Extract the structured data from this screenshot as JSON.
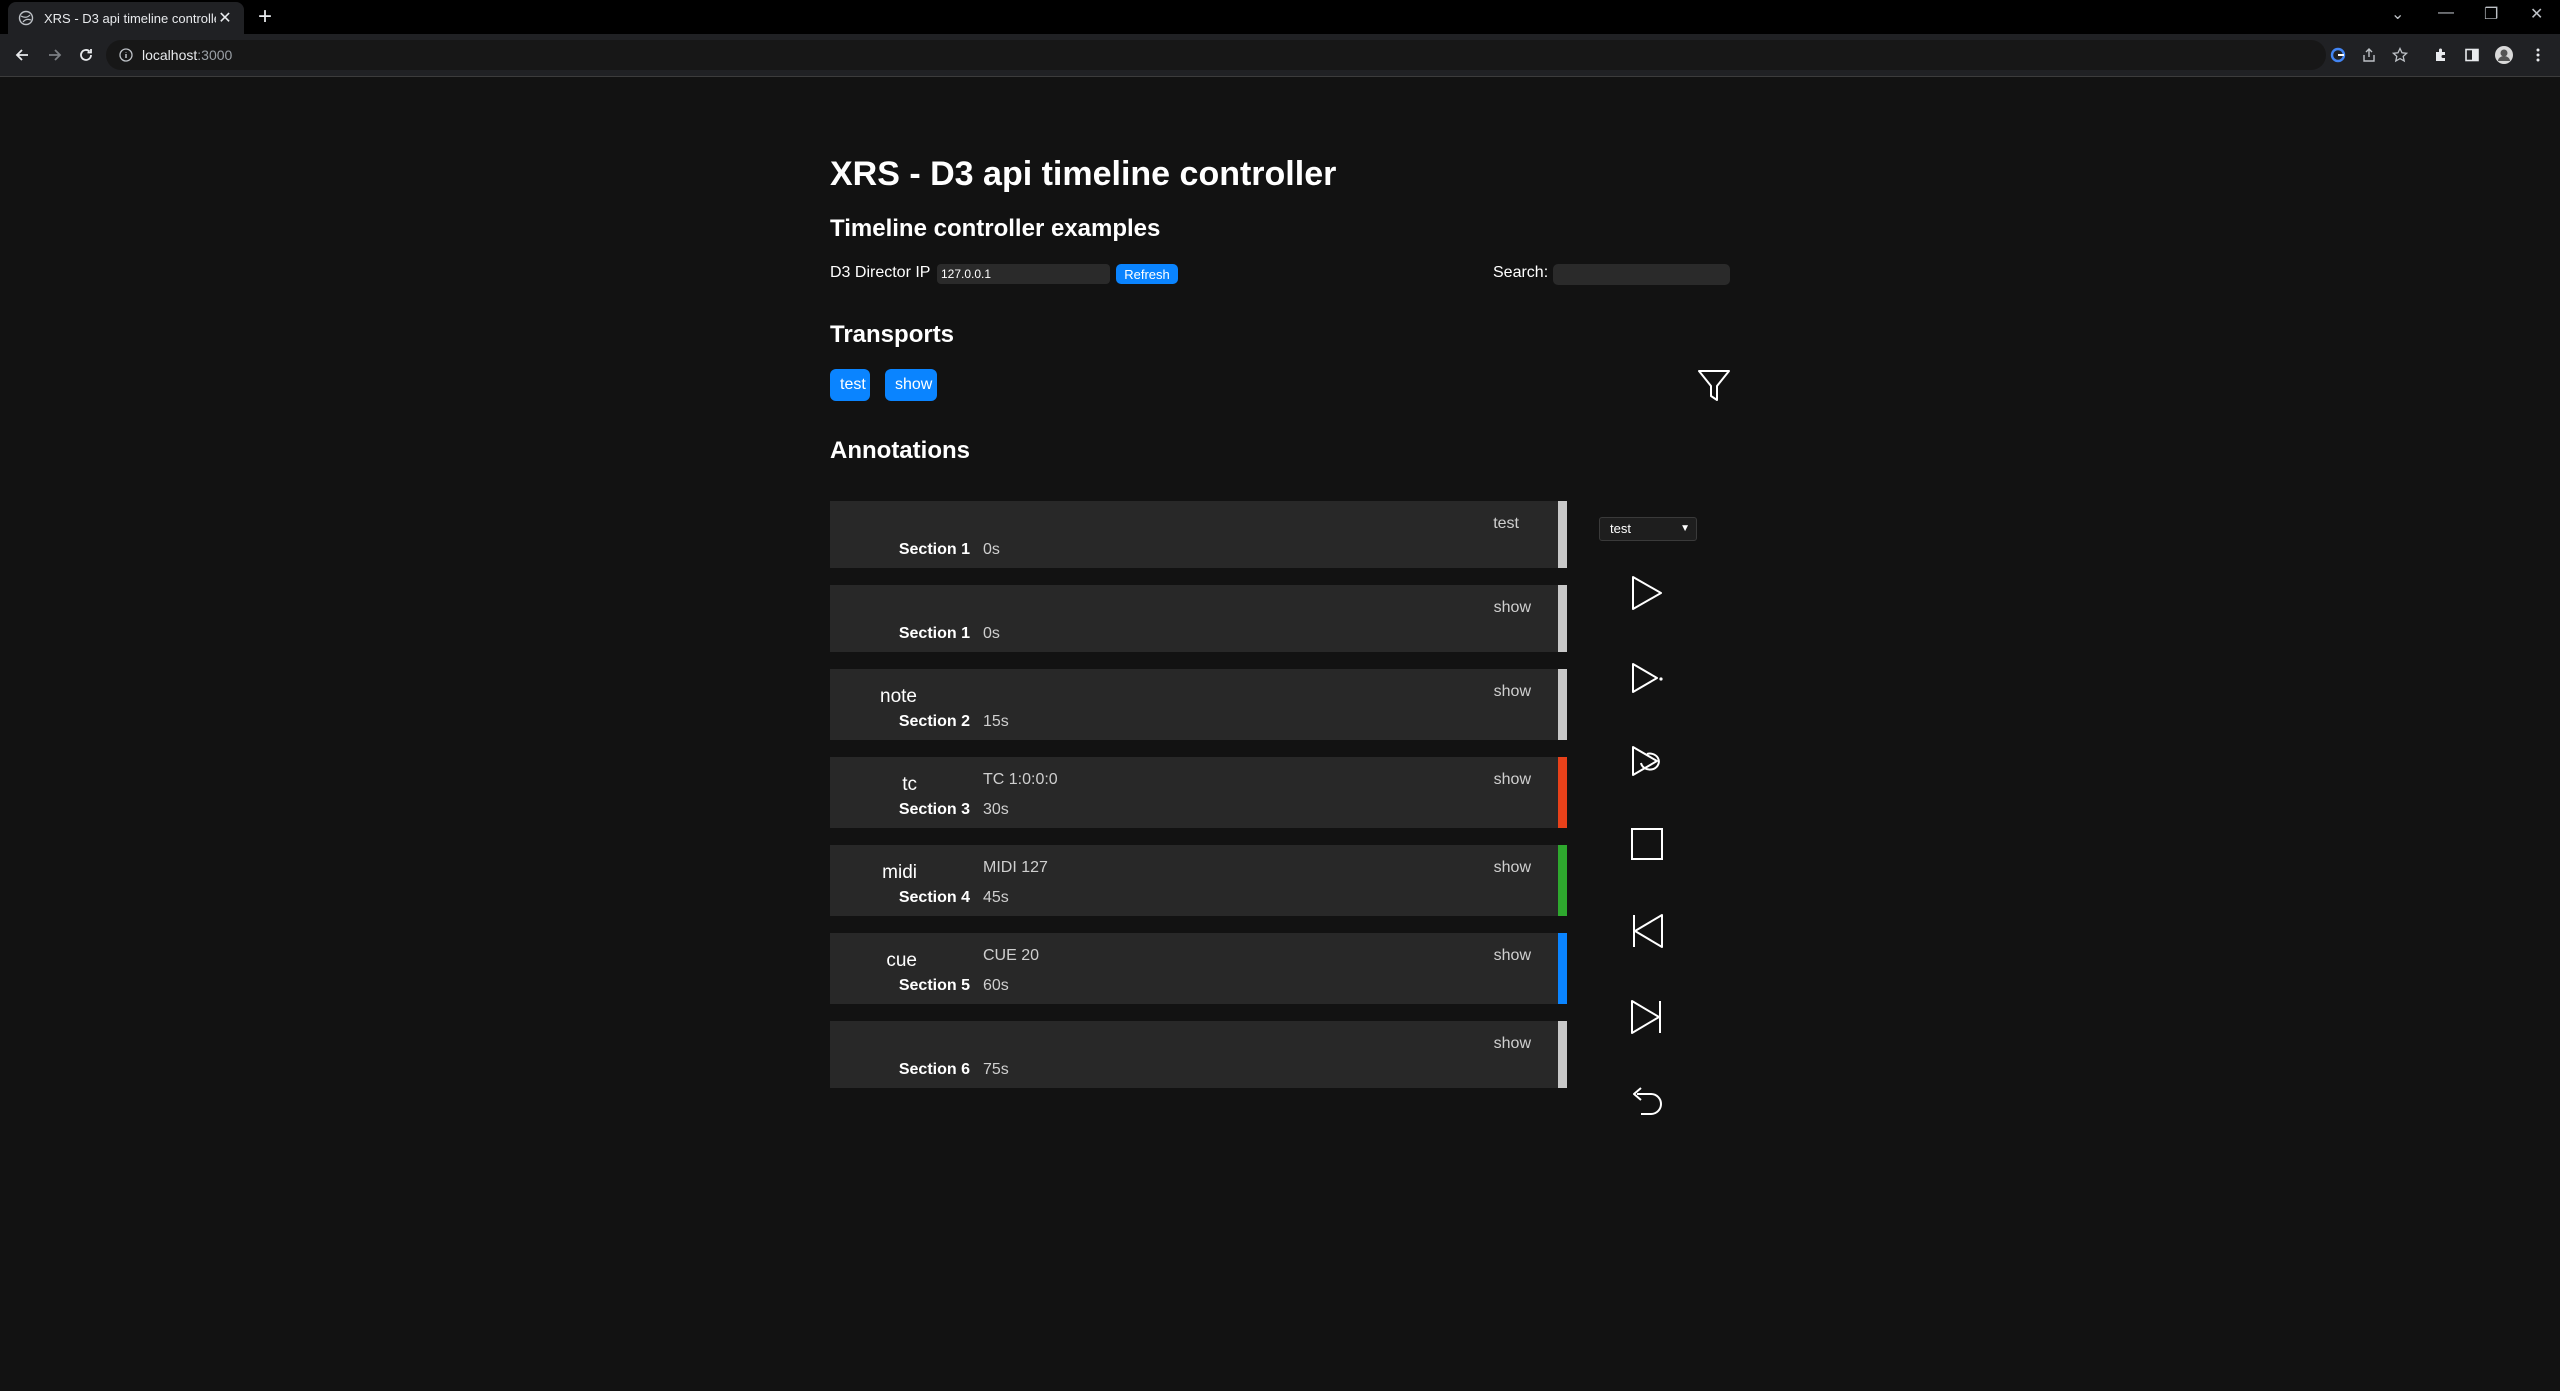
{
  "browser": {
    "tab_title": "XRS - D3 api timeline controller",
    "tab_close": "✕",
    "new_tab": "+",
    "url_host": "localhost",
    "url_port": ":3000",
    "window_controls": [
      "⌄",
      "—",
      "❐",
      "✕"
    ]
  },
  "page": {
    "title": "XRS - D3 api timeline controller",
    "subtitle": "Timeline controller examples",
    "director_ip_label": "D3 Director IP",
    "director_ip_value": "127.0.0.1",
    "refresh_label": "Refresh",
    "search_label": "Search:",
    "search_value": "",
    "transports_heading": "Transports",
    "transports": [
      "test",
      "show"
    ],
    "annotations_heading": "Annotations"
  },
  "annotations": [
    {
      "type": "",
      "value": "",
      "section": "Section 1",
      "time": "0s",
      "transport": "test",
      "color": "#c8c8c8"
    },
    {
      "type": "",
      "value": "",
      "section": "Section 1",
      "time": "0s",
      "transport": "show",
      "color": "#c8c8c8"
    },
    {
      "type": "note",
      "value": "",
      "section": "Section 2",
      "time": "15s",
      "transport": "show",
      "color": "#c8c8c8"
    },
    {
      "type": "tc",
      "value": "TC 1:0:0:0",
      "section": "Section 3",
      "time": "30s",
      "transport": "show",
      "color": "#e8411a"
    },
    {
      "type": "midi",
      "value": "MIDI 127",
      "section": "Section 4",
      "time": "45s",
      "transport": "show",
      "color": "#2ea82e"
    },
    {
      "type": "cue",
      "value": "CUE 20",
      "section": "Section 5",
      "time": "60s",
      "transport": "show",
      "color": "#0a84ff"
    },
    {
      "type": "",
      "value": "",
      "section": "Section 6",
      "time": "75s",
      "transport": "show",
      "color": "#c8c8c8"
    }
  ],
  "controls": {
    "transport_select_value": "test",
    "buttons": [
      "play-icon",
      "play-to-end-icon",
      "play-loop-icon",
      "stop-icon",
      "previous-section-icon",
      "next-section-icon",
      "return-to-start-icon"
    ]
  },
  "icons": {
    "filter": "filter-icon"
  }
}
